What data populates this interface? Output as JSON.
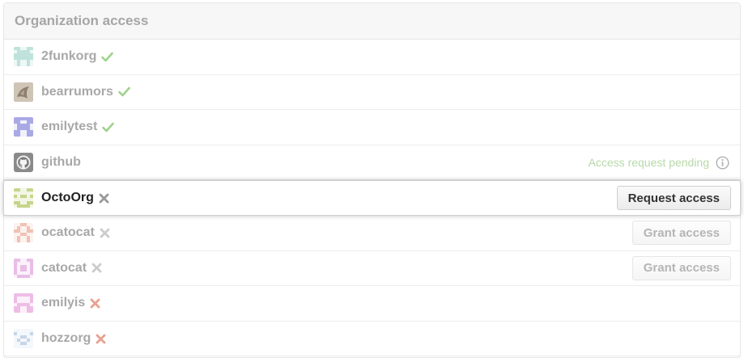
{
  "header": {
    "title": "Organization access"
  },
  "orgs": [
    {
      "name": "2funkorg",
      "status": "check"
    },
    {
      "name": "bearrumors",
      "status": "check"
    },
    {
      "name": "emilytest",
      "status": "check"
    },
    {
      "name": "github",
      "status": "pending",
      "pending_text": "Access request pending"
    },
    {
      "name": "OctoOrg",
      "status": "cross",
      "action": "Request access"
    },
    {
      "name": "ocatocat",
      "status": "cross",
      "action": "Grant access"
    },
    {
      "name": "catocat",
      "status": "cross",
      "action": "Grant access"
    },
    {
      "name": "emilyis",
      "status": "cross"
    },
    {
      "name": "hozzorg",
      "status": "cross"
    }
  ],
  "colors": {
    "check": "#9fd28c",
    "cross_gray": "#999999",
    "cross_light": "#cccccc",
    "cross_red": "#e8a190",
    "pending": "#b7d9a8"
  },
  "icons": {
    "granted": "check-icon",
    "denied": "x-icon",
    "info": "info-icon"
  }
}
